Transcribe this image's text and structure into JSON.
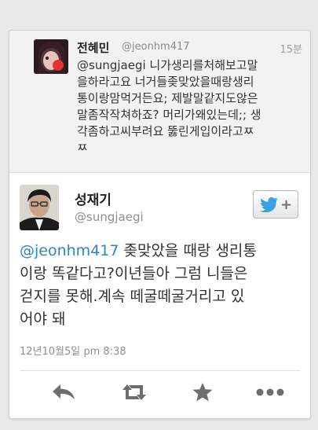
{
  "reply_tweet": {
    "name": "전혜민",
    "handle": "@jeonhm417",
    "time": "15분",
    "text": "@sungjaegi 니가생리를처해보고말\n을하라고요 너거들좆맞았을때랑생리\n통이랑맘먹거든요; 제발말같지도않은\n말좀작작쳐하죠? 머리가왜있는데;; 생\n각좀하고씨부려요 뚫린게입이라고ㅉ\nㅉ",
    "avatar_icon": "user-photo"
  },
  "main_tweet": {
    "name": "성재기",
    "handle": "@sungjaegi",
    "mention": "@jeonhm417",
    "text": " 좆맞았을 때랑 생리통\n이랑 똑같다고?이년들아 그럼 니들은\n걷지를 못해.계속 떼굴떼굴거리고 있\n어야 돼",
    "date": "12년10월5일 pm 8:38",
    "avatar_icon": "user-photo"
  },
  "follow_button": {
    "icon": "twitter-bird-icon",
    "plus": "+"
  },
  "actions": [
    {
      "name": "reply",
      "icon": "reply-icon"
    },
    {
      "name": "retweet",
      "icon": "retweet-icon"
    },
    {
      "name": "favorite",
      "icon": "star-icon"
    },
    {
      "name": "more",
      "icon": "more-icon"
    }
  ],
  "colors": {
    "mention": "#2b87c4",
    "twitter_bird": "#3aa1e3",
    "action_icon": "#6e6e6e"
  }
}
